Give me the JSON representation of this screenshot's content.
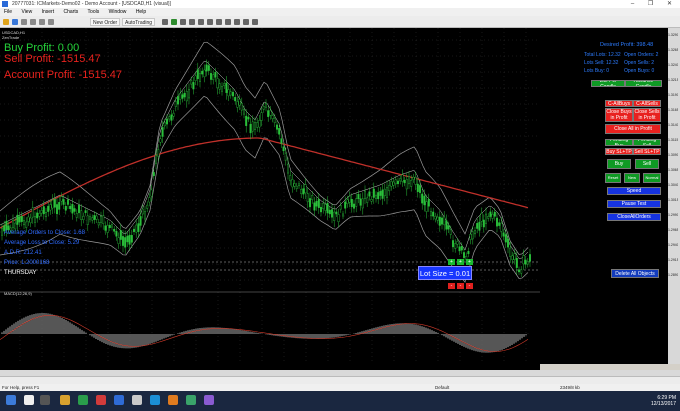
{
  "window": {
    "title": "20777031: ICMarkets-Demo02 - Demo Account - [USDCAD,H1 (visual)]",
    "controls": "– ❐ ✕"
  },
  "menu": [
    "File",
    "View",
    "Insert",
    "Charts",
    "Tools",
    "Window",
    "Help"
  ],
  "toolbar": {
    "new_order": "New Order",
    "autotrading": "AutoTrading"
  },
  "chart": {
    "header_line1": "USDCAD,H1",
    "header_line2": "ZenTrade",
    "buy_profit": "Buy Profit: 0.00",
    "sell_profit": "Sell Profit: -1515.47",
    "account_profit": "Account Profit: -1515.47",
    "avg_orders": "Average Orders to Close: 1.68",
    "avg_loss": "Average Loss to Close: 5.29",
    "adr": "A.D.R: 212.41",
    "price_line": "Price: 1.2000168",
    "day": "THURSDAY",
    "colors": {
      "buy_profit": "#25d33a",
      "sell_profit": "#e8221d",
      "account_profit": "#e8221d"
    }
  },
  "panel": {
    "desired_profit": "Desired Profit: 398.48",
    "total_lots": "Total Lots: 12.32",
    "open_orders": "Open Orders: 2",
    "lots_sell": "Lots Sell: 12.32",
    "open_sells": "Open Sells: 2",
    "lots_buy": "Lots Buy: 0",
    "open_buys": "Open Buys: 0",
    "lite_pin_candle": "Lite Pin Candle",
    "advance_candle": "Advance Candle",
    "c_all_buys": "C-AllBuys",
    "c_all_sells": "C-AllSells",
    "close_buys_profit": "Close Buys in Profit",
    "close_sells_profit": "Close Sells in Profit",
    "close_all_profit": "Close All in Profit",
    "pending_buy": "Pending Buy",
    "pending_sell": "Pending Sell",
    "buy_sl_tp": "Buy SL+TP",
    "sell_sl_tp": "Sell SL+TP",
    "buy": "Buy",
    "sell": "Sell",
    "reset": "Reset",
    "new": "New",
    "normal": "Normal",
    "speed": "Speed",
    "pause_test": "Pause Test",
    "close_all_orders": "CloseAllOrders",
    "delete_all_objects": "Delete All Objects"
  },
  "lot_size": "Lot Size = 0.01",
  "mini_buttons": {
    "plus": "+",
    "minus": "-"
  },
  "indicator": {
    "label": "MACD(12,26,9)"
  },
  "time_labels": [
    "22 Jun 2017",
    "23 Jun 09:00",
    "26 Jun 02:00",
    "27 Jun 18:00",
    "28 Jun 10:00",
    "29 Jun 02:00",
    "29 Jun 18:00",
    "30 Jun 10:00",
    "3 Jul 03:00",
    "3 Jul 19:00",
    "4 Jul 11:00",
    "5 Jul 03:00",
    "5 Jul 19:00",
    "6 Jul 11:00",
    "7 Jul 03:00",
    "7 Jul 19:00",
    "10 Jul 11:00",
    "11 Jul 03:00",
    "11 Jul 19:00",
    "12 Jul 11:00"
  ],
  "price_labels": [
    "1.3290",
    "1.3265",
    "1.3240",
    "1.3215",
    "1.3190",
    "1.3165",
    "1.3140",
    "1.3115",
    "1.3090",
    "1.3065",
    "1.3040",
    "1.3015",
    "1.2990",
    "1.2965",
    "1.2940",
    "1.2915",
    "1.2890"
  ],
  "tabs": [
    "USDCAD,M15",
    "GBPUSD,H4",
    "GBPUSD,H4",
    "AUDUSD,H1",
    "AUDUSD,H1",
    "USDCAD,H1",
    "USDCAD,H1 (visual)",
    "USDCAD,H1 (visual)",
    "USDCAD,H1 (visual)",
    "USDCAD,H1 (visual)",
    "USDCAD,H1 (visual)",
    "USDCAD,H1 (visual)",
    "USDCAD,H1 (visual)",
    "USDCAD,H1 (visual)",
    "USDCAD,H1 (visual)",
    "USDCAD,H1 (visual)"
  ],
  "status": {
    "help": "For Help, press F1",
    "profile": "Default",
    "conn": "2349/8 kb"
  },
  "taskbar": {
    "time": "6:29 PM",
    "date": "12/13/2017"
  }
}
